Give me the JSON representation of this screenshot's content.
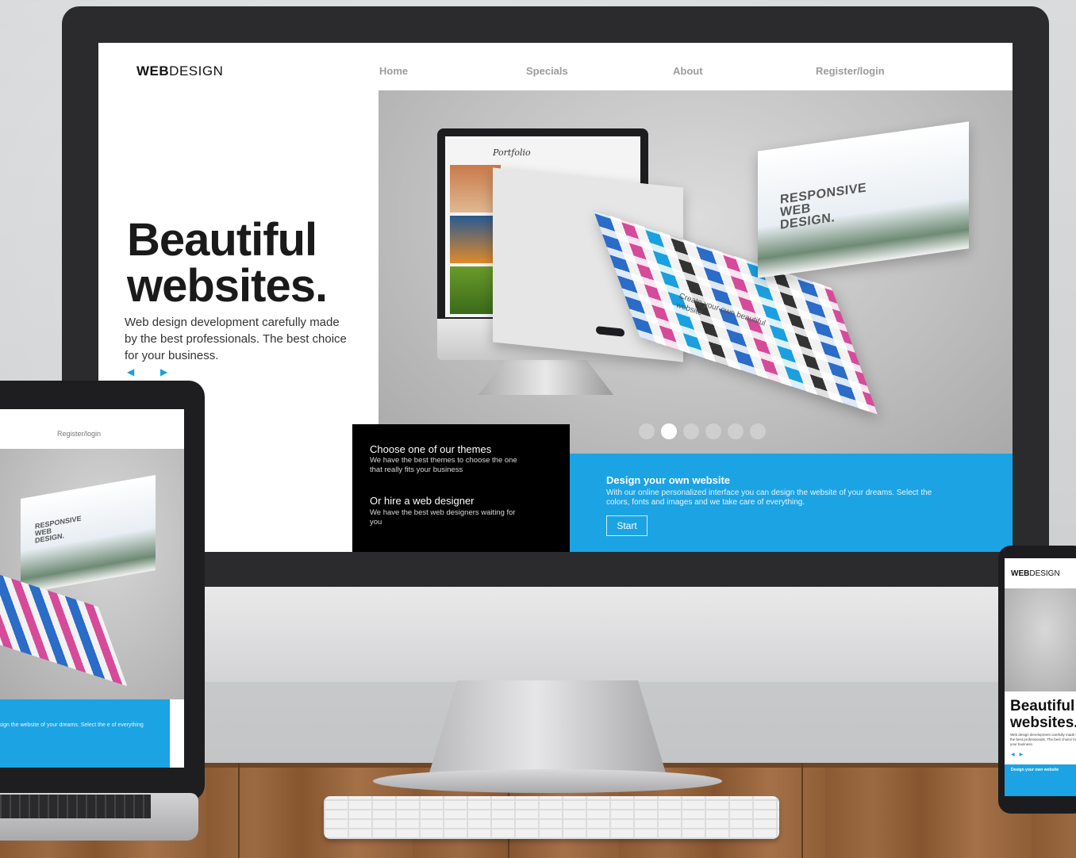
{
  "desktop": {
    "nav": {
      "logo_bold": "WEB",
      "logo_light": "DESIGN",
      "items": [
        "Home",
        "Specials",
        "About",
        "Register/login"
      ]
    },
    "hero": {
      "title_line1": "Beautiful",
      "title_line2": "websites.",
      "subtitle": "Web design development carefully made by the best professionals. The best choice for your business.",
      "prev_arrow": "◀",
      "next_arrow": "▶",
      "image_text": {
        "portfolio": "Portfolio",
        "responsive": "RESPONSIVE WEB DESIGN.",
        "create": "Create your own beautiful website"
      },
      "carousel_dots": 6,
      "carousel_active_index": 1
    },
    "themes_box": {
      "title1": "Choose one of our themes",
      "text1": "We have the best themes to choose the one that really fits your business",
      "title2": "Or hire a web designer",
      "text2": "We have the best web designers waiting for you"
    },
    "design_box": {
      "title": "Design your own website",
      "text": "With our online personalized interface you can design the website of your dreams. Select the colors, fonts and images and we take care of everything.",
      "button": "Start"
    }
  },
  "laptop": {
    "nav_item": "Register/login",
    "card_title": "RESPONSIVE WEB DESIGN.",
    "blue_text": "can design the website of your dreams. Select the e of everything"
  },
  "phone": {
    "logo_bold": "WEB",
    "logo_light": "DESIGN",
    "title_line1": "Beautiful",
    "title_line2": "websites.",
    "subtitle": "Web design development carefully made by the best professionals. The best choice for your business.",
    "blue_title": "Design your own website"
  },
  "colors": {
    "accent_blue": "#1ca3e4",
    "black_panel": "#000000",
    "monitor_bezel": "#2b2b2d"
  }
}
